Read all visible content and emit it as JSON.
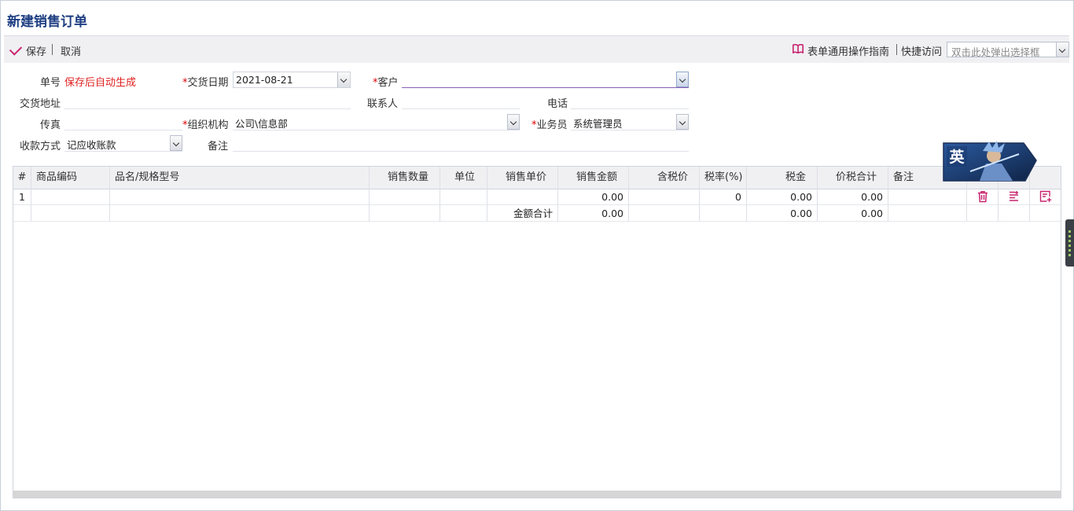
{
  "page": {
    "title": "新建销售订单"
  },
  "toolbar": {
    "save_label": "保存",
    "cancel_label": "取消",
    "guide_label": "表单通用操作指南",
    "quick_access_label": "快捷访问",
    "quick_access_placeholder": "双击此处弹出选择框"
  },
  "form": {
    "order_no_label": "单号",
    "order_no_value": "保存后自动生成",
    "delivery_date_label": "交货日期",
    "delivery_date_value": "2021-08-21",
    "customer_label": "客户",
    "customer_value": "",
    "delivery_address_label": "交货地址",
    "delivery_address_value": "",
    "contact_label": "联系人",
    "contact_value": "",
    "phone_label": "电话",
    "phone_value": "",
    "fax_label": "传真",
    "fax_value": "",
    "org_label": "组织机构",
    "org_value": "公司\\信息部",
    "salesperson_label": "业务员",
    "salesperson_value": "系统管理员",
    "payment_label": "收款方式",
    "payment_value": "记应收账款",
    "remark_label": "备注",
    "remark_value": "",
    "required_mark": "*"
  },
  "grid": {
    "columns": [
      "#",
      "商品编码",
      "品名/规格型号",
      "销售数量",
      "单位",
      "销售单价",
      "销售金额",
      "含税价",
      "税率(%)",
      "税金",
      "价税合计",
      "备注"
    ],
    "rows": [
      {
        "no": "1",
        "code": "",
        "name": "",
        "qty": "",
        "unit": "",
        "price": "",
        "amount": "0.00",
        "tax_price": "",
        "tax_rate": "0",
        "tax": "0.00",
        "total": "0.00",
        "remark": ""
      }
    ],
    "summary": {
      "label": "金额合计",
      "amount": "0.00",
      "tax": "0.00",
      "total": "0.00"
    }
  },
  "badge": {
    "text": "英"
  },
  "colors": {
    "accent": "#c8246f",
    "title": "#1f3f82",
    "required": "#dd0000"
  },
  "icons": [
    "check-icon",
    "book-icon",
    "chevron-down-icon",
    "trash-icon",
    "insert-row-icon",
    "add-row-icon"
  ]
}
